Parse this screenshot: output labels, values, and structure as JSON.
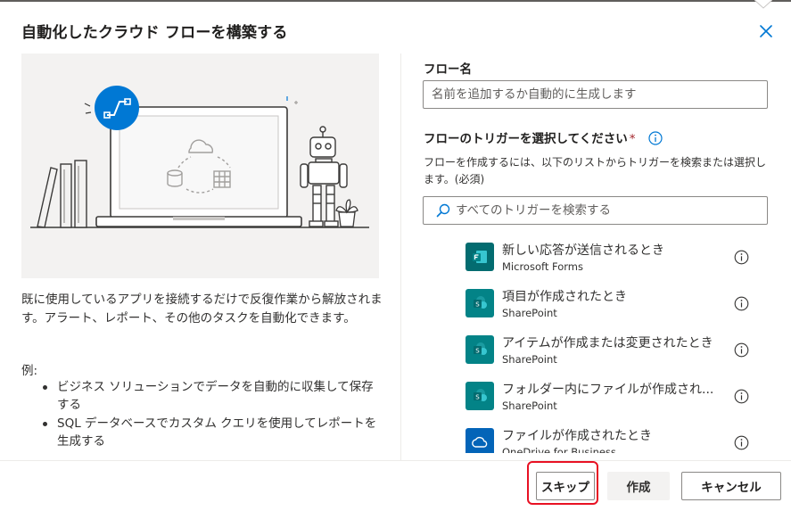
{
  "dialog": {
    "title": "自動化したクラウド フローを構築する",
    "close_icon": "close-icon"
  },
  "left": {
    "description": "既に使用しているアプリを接続するだけで反復作業から解放されます。アラート、レポート、その他のタスクを自動化できます。",
    "example_label": "例:",
    "examples": [
      "ビジネス ソリューションでデータを自動的に収集して保存する",
      "SQL データベースでカスタム クエリを使用してレポートを生成する"
    ]
  },
  "form": {
    "flow_name_label": "フロー名",
    "flow_name_value": "",
    "flow_name_placeholder": "名前を追加するか自動的に生成します",
    "trigger_label": "フローのトリガーを選択してください",
    "required_mark": "*",
    "trigger_hint": "フローを作成するには、以下のリストからトリガーを検索または選択します。(必須)",
    "search_placeholder": "すべてのトリガーを検索する"
  },
  "triggers": [
    {
      "title": "新しい応答が送信されるとき",
      "service": "Microsoft Forms",
      "icon": "forms-icon",
      "color": "#036c70"
    },
    {
      "title": "項目が作成されたとき",
      "service": "SharePoint",
      "icon": "sharepoint-icon",
      "color": "#038387"
    },
    {
      "title": "アイテムが作成または変更されたとき",
      "service": "SharePoint",
      "icon": "sharepoint-icon",
      "color": "#038387"
    },
    {
      "title": "フォルダー内にファイルが作成され...",
      "service": "SharePoint",
      "icon": "sharepoint-icon",
      "color": "#038387"
    },
    {
      "title": "ファイルが作成されたとき",
      "service": "OneDrive for Business",
      "icon": "onedrive-icon",
      "color": "#0364b8"
    }
  ],
  "footer": {
    "skip_label": "スキップ",
    "create_label": "作成",
    "cancel_label": "キャンセル"
  },
  "colors": {
    "accent": "#0078d4",
    "highlight": "#e81123",
    "required": "#a4262c"
  }
}
